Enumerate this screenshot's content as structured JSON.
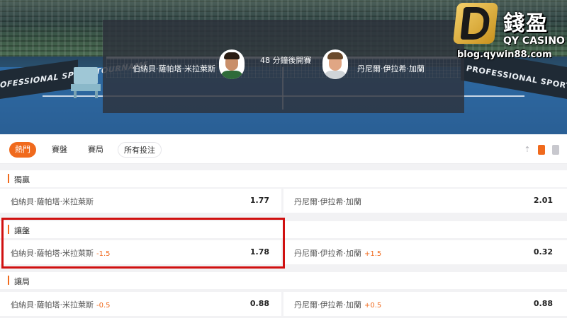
{
  "match": {
    "player_a": "伯納貝·薩帕塔·米拉萊斯",
    "player_b": "丹尼爾·伊拉希·加蘭",
    "start_text": "48 分鐘後開賽",
    "banner_left": "OFESSIONAL SPORT TOURNAME",
    "banner_right": "PROFESSIONAL SPORT TOURNA"
  },
  "logo": {
    "title": "錢盈",
    "subtitle": "QY CASINO",
    "url": "blog.qywin88.com"
  },
  "tabs": [
    {
      "label": "熱門",
      "active": true
    },
    {
      "label": "賽盤",
      "active": false
    },
    {
      "label": "賽局",
      "active": false
    },
    {
      "label": "所有投注",
      "active": false
    }
  ],
  "markets": [
    {
      "title": "獨贏",
      "left": {
        "name": "伯納貝·薩帕塔·米拉萊斯",
        "handicap": "",
        "odds": "1.77"
      },
      "right": {
        "name": "丹尼爾·伊拉希·加蘭",
        "handicap": "",
        "odds": "2.01"
      }
    },
    {
      "title": "讓盤",
      "left": {
        "name": "伯納貝·薩帕塔·米拉萊斯",
        "handicap": "-1.5",
        "odds": "1.78"
      },
      "right": {
        "name": "丹尼爾·伊拉希·加蘭",
        "handicap": "+1.5",
        "odds": "0.32"
      }
    },
    {
      "title": "讓局",
      "left": {
        "name": "伯納貝·薩帕塔·米拉萊斯",
        "handicap": "-0.5",
        "odds": "0.88"
      },
      "right": {
        "name": "丹尼爾·伊拉希·加蘭",
        "handicap": "+0.5",
        "odds": "0.88"
      }
    }
  ],
  "colors": {
    "accent": "#f06a1d",
    "highlight": "#d01010"
  }
}
